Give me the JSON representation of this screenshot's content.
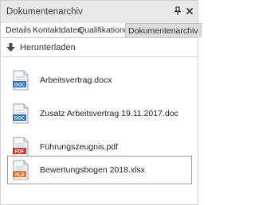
{
  "window": {
    "title": "Dokumentenarchiv",
    "pin_icon": "pin-icon",
    "close_icon": "close-icon"
  },
  "tabs": [
    {
      "label": "Details",
      "active": false
    },
    {
      "label": "Kontaktdaten",
      "active": false
    },
    {
      "label": "Qualifikationen",
      "active": false
    },
    {
      "label": "Dokumentenarchiv",
      "active": true
    }
  ],
  "toolbar": {
    "download_label": "Herunterladen",
    "download_icon": "download-arrow-icon"
  },
  "documents": [
    {
      "name": "Arbeitsvertrag.docx",
      "type": "DOC",
      "color": "#2b6cc4",
      "selected": false
    },
    {
      "name": "Zusatz Arbeitsvertrag 19.11.2017.doc",
      "type": "DOC",
      "color": "#2b6cc4",
      "selected": false
    },
    {
      "name": "Führungszeugnis.pdf",
      "type": "PDF",
      "color": "#c0392b",
      "selected": false
    },
    {
      "name": "Bewertungsbogen 2018.xlsx",
      "type": "XLS",
      "color": "#e0742a",
      "selected": true
    }
  ]
}
